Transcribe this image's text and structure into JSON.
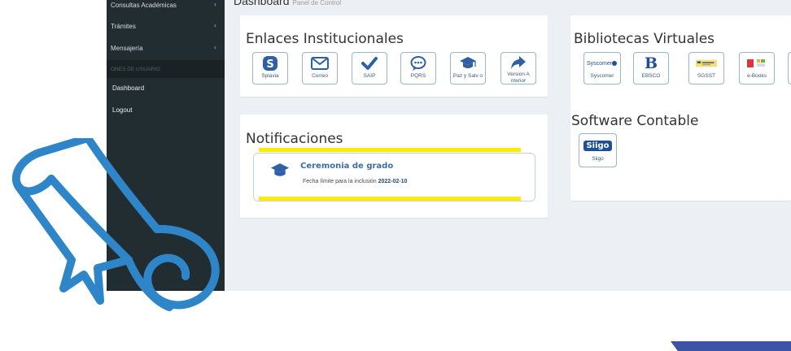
{
  "sidebar": {
    "items": [
      {
        "label": "Consultas Académicas",
        "chevron": "‹"
      },
      {
        "label": "Trámites",
        "chevron": "‹"
      },
      {
        "label": "Mensajería",
        "chevron": "‹"
      }
    ],
    "section_header": "ONES DE USUARIO",
    "sub_items": [
      {
        "label": "Dashboard"
      },
      {
        "label": "Logout"
      }
    ]
  },
  "header": {
    "title": "Dashboard",
    "subtitle": "Panel de Control"
  },
  "enlaces": {
    "title": "Enlaces Institucionales",
    "tiles": [
      {
        "label": "Splavia",
        "icon": "skype-icon"
      },
      {
        "label": "Correo",
        "icon": "mail-icon"
      },
      {
        "label": "SAIP",
        "icon": "check-icon"
      },
      {
        "label": "PQRS",
        "icon": "chat-bubble-icon"
      },
      {
        "label": "Paz y Salv o",
        "icon": "graduation-cap-icon"
      },
      {
        "label": "Version A nterior",
        "icon": "share-arrow-icon"
      }
    ]
  },
  "bibliotecas": {
    "title": "Bibliotecas Virtuales",
    "tiles": [
      {
        "label": "Syscomer",
        "logo_text": "Syscomer"
      },
      {
        "label": "EBSCO",
        "logo_text": "B"
      },
      {
        "label": "SGSST",
        "logo_text": ""
      },
      {
        "label": "e-Books",
        "logo_text": ""
      }
    ]
  },
  "software": {
    "title": "Software Contable",
    "tiles": [
      {
        "label": "Siigo",
        "logo_text": "Siigo"
      }
    ]
  },
  "notificaciones": {
    "title": "Notificaciones",
    "card": {
      "title": "Ceremonia de grado",
      "subtitle": "Fecha límite para la inclusión",
      "date": "2022-02-10"
    }
  },
  "colors": {
    "sidebar_bg": "#222d32",
    "accent_blue": "#3c8dbc",
    "highlight": "#ffeb00",
    "diploma_blue": "#2e86c9"
  }
}
